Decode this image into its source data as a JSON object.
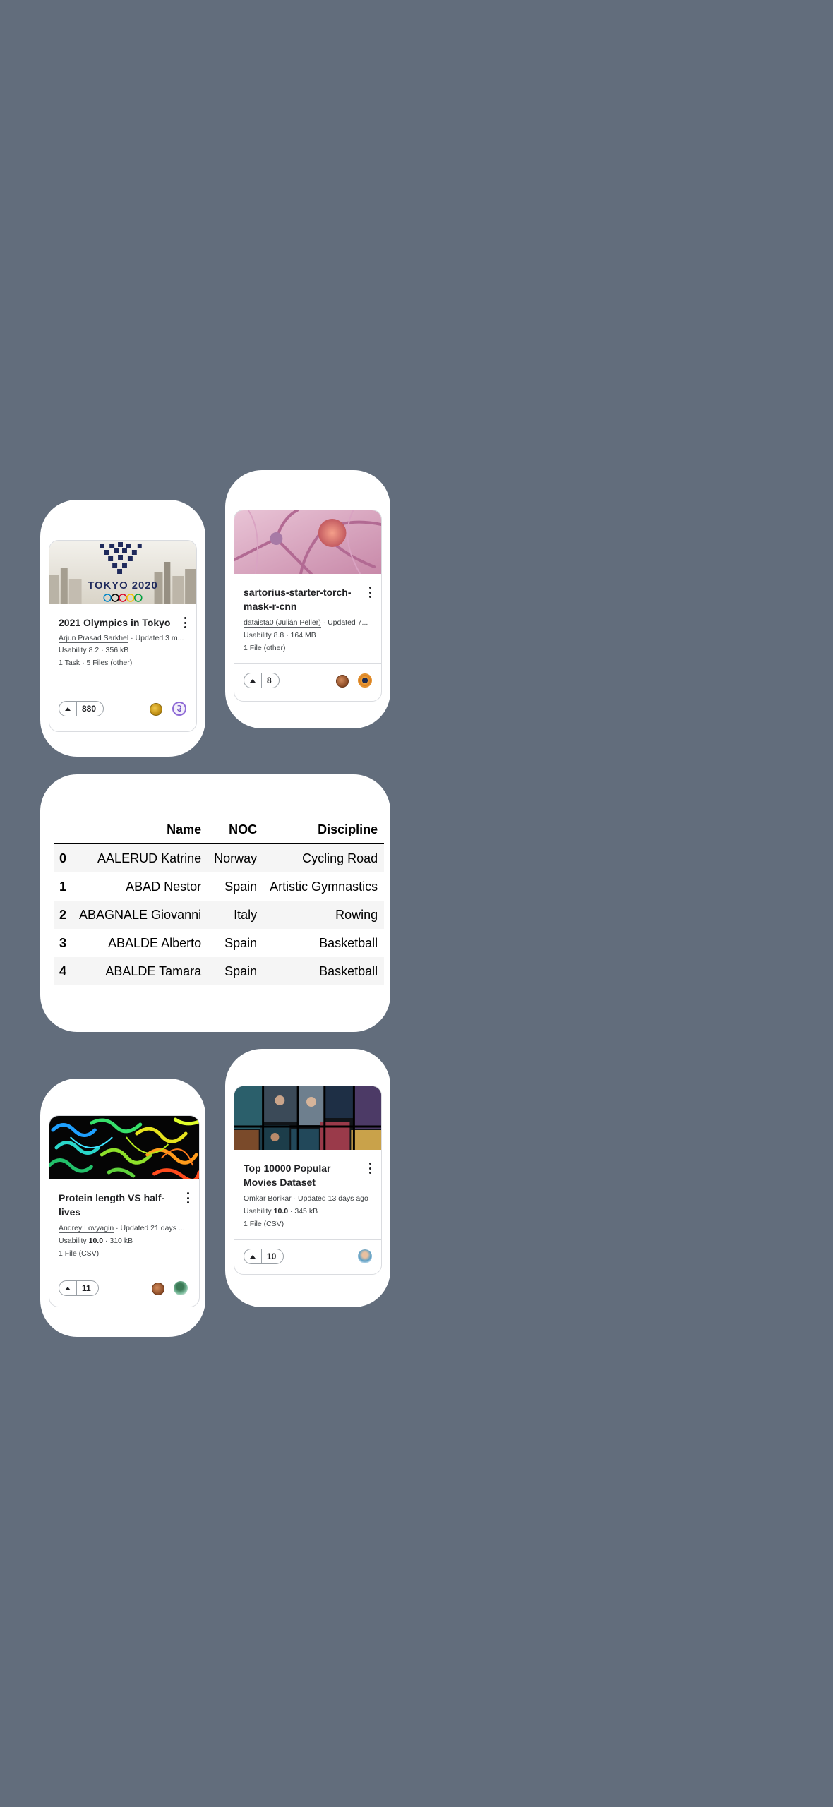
{
  "cards": {
    "tokyo": {
      "title": "2021 Olympics in Tokyo",
      "author": "Arjun Prasad Sarkhel",
      "updated": "· Updated 3 m...",
      "usability_label": "Usability",
      "usability": "8.2",
      "size": "· 356 kB",
      "files": "1 Task · 5 Files (other)",
      "votes": "880",
      "image_text": "TOKYO 2020"
    },
    "sartorius": {
      "title_line1": "sartorius-starter-torch-",
      "title_line2": "mask-r-cnn",
      "author": "dataista0 (Julián Peller)",
      "updated": "· Updated 7...",
      "usability_label": "Usability",
      "usability": "8.8",
      "size": "· 164 MB",
      "files": "1 File (other)",
      "votes": "8"
    },
    "protein": {
      "title_line1": "Protein length VS half-",
      "title_line2": "lives",
      "author": "Andrey Lovyagin",
      "updated": "· Updated 21 days ...",
      "usability_label": "Usability",
      "usability": "10.0",
      "size": "· 310 kB",
      "files": "1 File (CSV)",
      "votes": "11"
    },
    "movies": {
      "title_line1": "Top 10000 Popular",
      "title_line2": "Movies Dataset",
      "author": "Omkar Borikar",
      "updated": "· Updated 13 days ago",
      "usability_label": "Usability",
      "usability": "10.0",
      "size": "· 345 kB",
      "files": "1 File (CSV)",
      "votes": "10"
    }
  },
  "table": {
    "columns": [
      "",
      "Name",
      "NOC",
      "Discipline"
    ],
    "rows": [
      [
        "0",
        "AALERUD Katrine",
        "Norway",
        "Cycling Road"
      ],
      [
        "1",
        "ABAD Nestor",
        "Spain",
        "Artistic Gymnastics"
      ],
      [
        "2",
        "ABAGNALE Giovanni",
        "Italy",
        "Rowing"
      ],
      [
        "3",
        "ABALDE Alberto",
        "Spain",
        "Basketball"
      ],
      [
        "4",
        "ABALDE Tamara",
        "Spain",
        "Basketball"
      ]
    ]
  },
  "colors": {
    "background": "#626d7c",
    "panel": "#ffffff",
    "medal_gold": "#c99a1a",
    "medal_bronze": "#a5643a"
  },
  "icons": [
    "more-vert-icon",
    "upvote-arrow-icon",
    "medal-icon",
    "avatar"
  ]
}
